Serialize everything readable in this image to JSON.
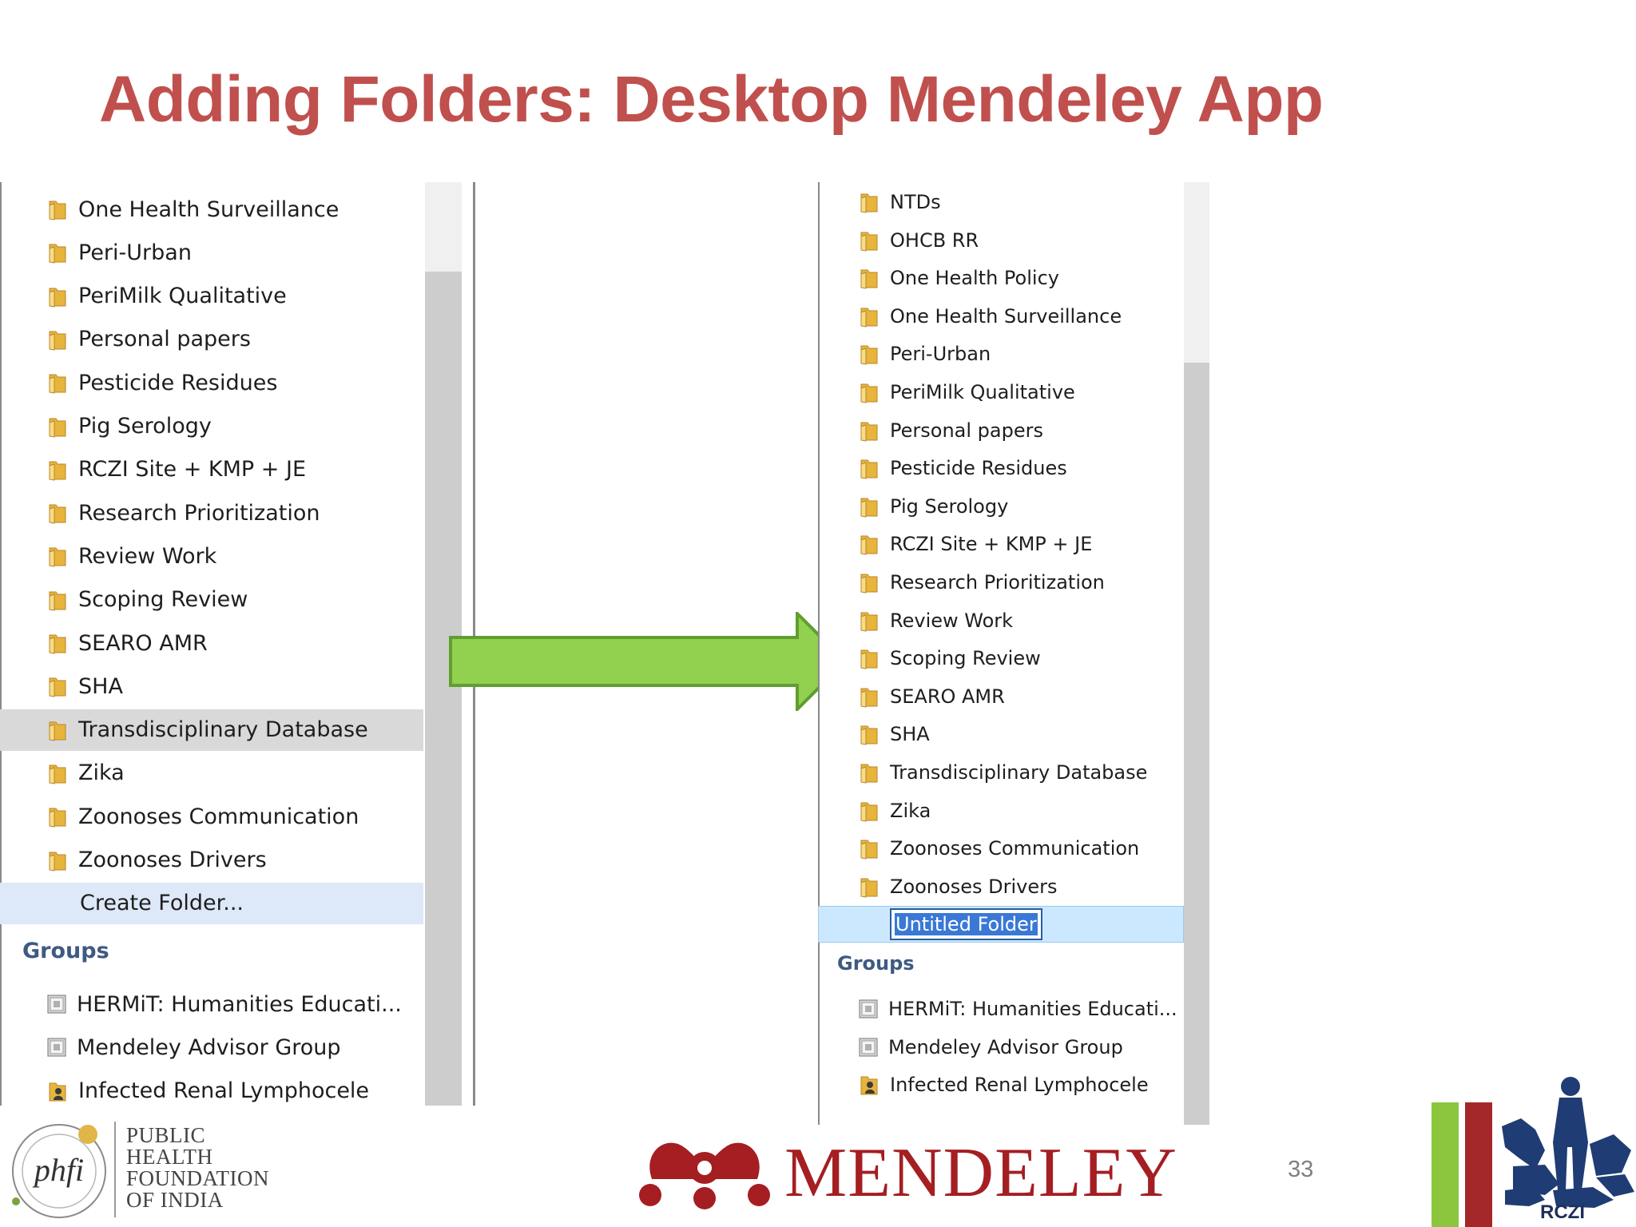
{
  "slide": {
    "title": "Adding Folders: Desktop Mendeley App",
    "page_number": "33"
  },
  "left_panel": {
    "folders": [
      "One Health Surveillance",
      "Peri-Urban",
      "PeriMilk Qualitative",
      "Personal papers",
      "Pesticide Residues",
      "Pig Serology",
      "RCZI Site + KMP + JE",
      "Research Prioritization",
      "Review Work",
      "Scoping Review",
      "SEARO AMR",
      "SHA",
      "Transdisciplinary Database",
      "Zika",
      "Zoonoses Communication",
      "Zoonoses Drivers"
    ],
    "selected_folder": "Transdisciplinary Database",
    "create_folder_label": "Create Folder...",
    "groups_heading": "Groups",
    "groups": [
      "HERMiT: Humanities Educati...",
      "Mendeley Advisor Group",
      "Infected Renal Lymphocele"
    ]
  },
  "right_panel": {
    "folders": [
      "NTDs",
      "OHCB RR",
      "One Health Policy",
      "One Health Surveillance",
      "Peri-Urban",
      "PeriMilk Qualitative",
      "Personal papers",
      "Pesticide Residues",
      "Pig Serology",
      "RCZI Site + KMP + JE",
      "Research Prioritization",
      "Review Work",
      "Scoping Review",
      "SEARO AMR",
      "SHA",
      "Transdisciplinary Database",
      "Zika",
      "Zoonoses Communication",
      "Zoonoses Drivers"
    ],
    "new_folder_value": "Untitled Folder",
    "groups_heading": "Groups",
    "groups": [
      "HERMiT: Humanities Educati...",
      "Mendeley Advisor Group",
      "Infected Renal Lymphocele"
    ]
  },
  "footer": {
    "phfi_lines": [
      "PUBLIC",
      "HEALTH",
      "FOUNDATION",
      "OF INDIA"
    ],
    "phfi_mark": "phfi",
    "mendeley_word": "MENDELEY",
    "rczi_label": "RCZI"
  },
  "colors": {
    "title": "#c0504d",
    "arrow_fill": "#92d050",
    "arrow_stroke": "#5f9e2f",
    "selection_grey": "#d9d9d9",
    "create_row": "#dde8f8",
    "editing_row": "#cce8ff",
    "groups_heading": "#3e5a82",
    "mendeley_red": "#a41e22"
  },
  "icons": {
    "folder": "folder-icon",
    "group": "group-icon",
    "shared_group": "shared-group-icon",
    "arrow": "right-arrow-icon"
  }
}
